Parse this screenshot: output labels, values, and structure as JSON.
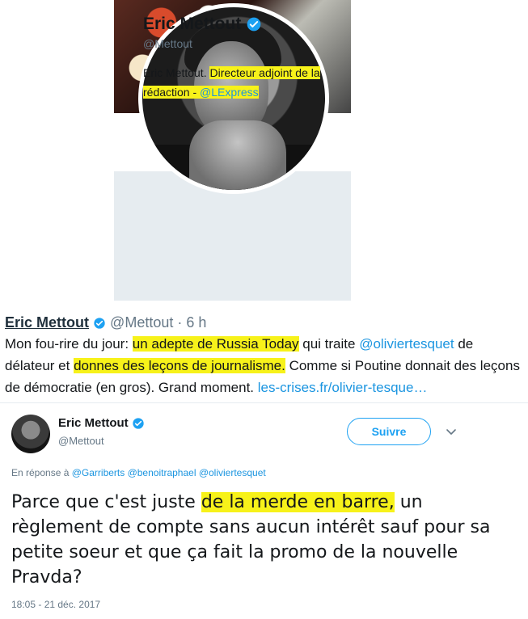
{
  "profile": {
    "name": "Eric Mettout",
    "handle": "@Mettout",
    "bio_prefix": "Eric Mettout. ",
    "bio_highlight": "Directeur adjoint de la rédaction - ",
    "bio_link": "@LExpress",
    "verified_icon": "verified-badge-icon"
  },
  "snippet": {
    "name": "Eric Mettout",
    "handle": "@Mettout",
    "separator": " · ",
    "time": "6 h",
    "text_1": "Mon fou-rire du jour: ",
    "text_hl_1": "un adepte de Russia Today",
    "text_2": " qui traite ",
    "mention": "@oliviertesquet",
    "text_3": " de délateur et ",
    "text_hl_2": "donnes des leçons de journalisme.",
    "text_4": " Comme si Poutine donnait des leçons de démocratie (en gros). Grand moment. ",
    "link": "les-crises.fr/olivier-tesque…"
  },
  "reply": {
    "name": "Eric Mettout",
    "handle": "@Mettout",
    "follow_label": "Suivre",
    "context_prefix": "En réponse à ",
    "context_mentions": "@Garriberts @benoitraphael @oliviertesquet",
    "text_1": "Parce que c'est juste ",
    "text_hl": "de la merde en barre,",
    "text_2": " un règlement de compte sans aucun intérêt sauf pour sa petite soeur et que ça fait la promo de la nouvelle Pravda?",
    "timestamp": "18:05 - 21 déc. 2017"
  },
  "colors": {
    "highlight": "#f7f21a",
    "link": "#1b95e0",
    "accent": "#1da1f2",
    "muted": "#657786",
    "verified": "#1da1f2"
  }
}
